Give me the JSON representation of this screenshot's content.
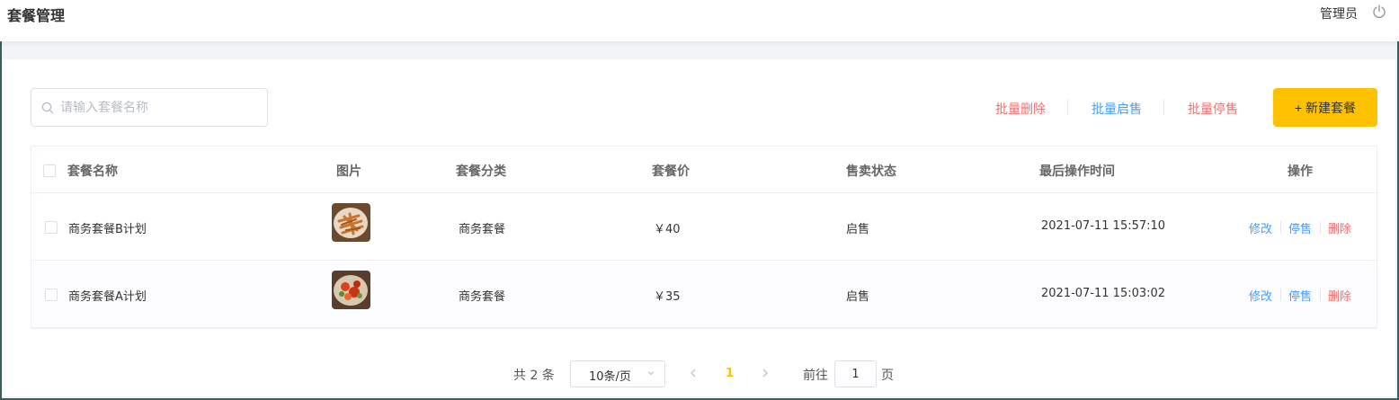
{
  "header": {
    "title": "套餐管理",
    "user_name": "管理员",
    "logout_icon": "power-icon"
  },
  "toolbar": {
    "search_placeholder": "请输入套餐名称",
    "batch_delete": "批量删除",
    "batch_enable": "批量启售",
    "batch_disable": "批量停售",
    "new_button": "+ 新建套餐"
  },
  "colors": {
    "accent": "#ffc200",
    "link_blue": "#419eff",
    "danger_red": "#f56c6c"
  },
  "table": {
    "columns": [
      "套餐名称",
      "图片",
      "套餐分类",
      "套餐价",
      "售卖状态",
      "最后操作时间",
      "操作"
    ],
    "rows": [
      {
        "name": "商务套餐B计划",
        "category": "商务套餐",
        "price": "￥40",
        "status": "启售",
        "updated": "2021-07-11 15:57:10",
        "actions": [
          "修改",
          "停售",
          "删除"
        ]
      },
      {
        "name": "商务套餐A计划",
        "category": "商务套餐",
        "price": "￥35",
        "status": "启售",
        "updated": "2021-07-11 15:03:02",
        "actions": [
          "修改",
          "停售",
          "删除"
        ]
      }
    ]
  },
  "pagination": {
    "total": "共 2 条",
    "page_size": "10条/页",
    "current_page": "1",
    "goto_label": "前往",
    "goto_value": "1",
    "page_suffix": "页"
  }
}
